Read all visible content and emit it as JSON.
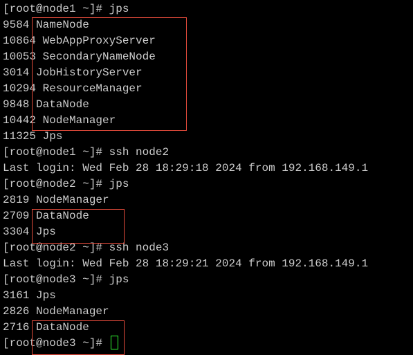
{
  "lines": {
    "l0": "[root@node1 ~]# jps",
    "l1": "9584 NameNode",
    "l2": "10864 WebAppProxyServer",
    "l3": "10053 SecondaryNameNode",
    "l4": "3014 JobHistoryServer",
    "l5": "10294 ResourceManager",
    "l6": "9848 DataNode",
    "l7": "10442 NodeManager",
    "l8": "11325 Jps",
    "l9": "[root@node1 ~]# ssh node2",
    "l10": "Last login: Wed Feb 28 18:29:18 2024 from 192.168.149.1",
    "l11": "[root@node2 ~]# jps",
    "l12": "2819 NodeManager",
    "l13": "2709 DataNode",
    "l14": "3304 Jps",
    "l15": "[root@node2 ~]# ssh node3",
    "l16": "Last login: Wed Feb 28 18:29:21 2024 from 192.168.149.1",
    "l17": "[root@node3 ~]# jps",
    "l18": "3161 Jps",
    "l19": "2826 NodeManager",
    "l20": "2716 DataNode",
    "l21": "[root@node3 ~]# "
  },
  "highlight_boxes": {
    "box1_processes": [
      "NameNode",
      "WebAppProxyServer",
      "SecondaryNameNode",
      "JobHistoryServer",
      "ResourceManager",
      "DataNode",
      "NodeManager"
    ],
    "box2_processes": [
      "NodeManager",
      "DataNode"
    ],
    "box3_processes": [
      "NodeManager",
      "DataNode"
    ]
  },
  "colors": {
    "background": "#000000",
    "text": "#cccccc",
    "highlight_border": "#e74c3c",
    "cursor": "#33ff33"
  }
}
